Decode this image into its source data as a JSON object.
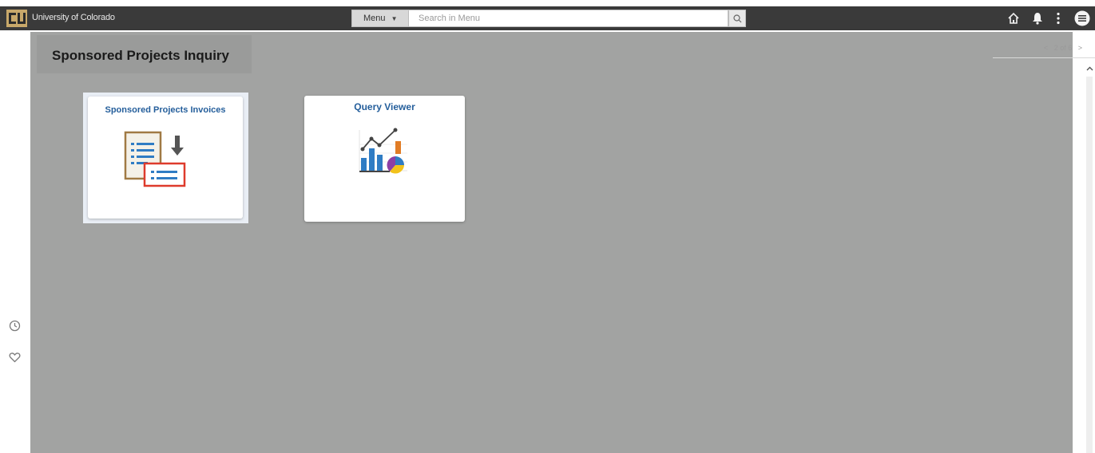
{
  "header": {
    "org_name": "University of Colorado",
    "menu_label": "Menu",
    "search_placeholder": "Search in Menu"
  },
  "page": {
    "title": "Sponsored Projects Inquiry",
    "pager": "2 of 6"
  },
  "tiles": [
    {
      "label": "Sponsored Projects Invoices",
      "icon": "invoice-list-download-icon"
    },
    {
      "label": "Query Viewer",
      "icon": "chart-analytics-icon"
    }
  ],
  "colors": {
    "topbar": "#3a3a3a",
    "content_bg": "#a2a3a2",
    "tile_title": "#245e9b",
    "logo_gold": "#c8a86a"
  }
}
